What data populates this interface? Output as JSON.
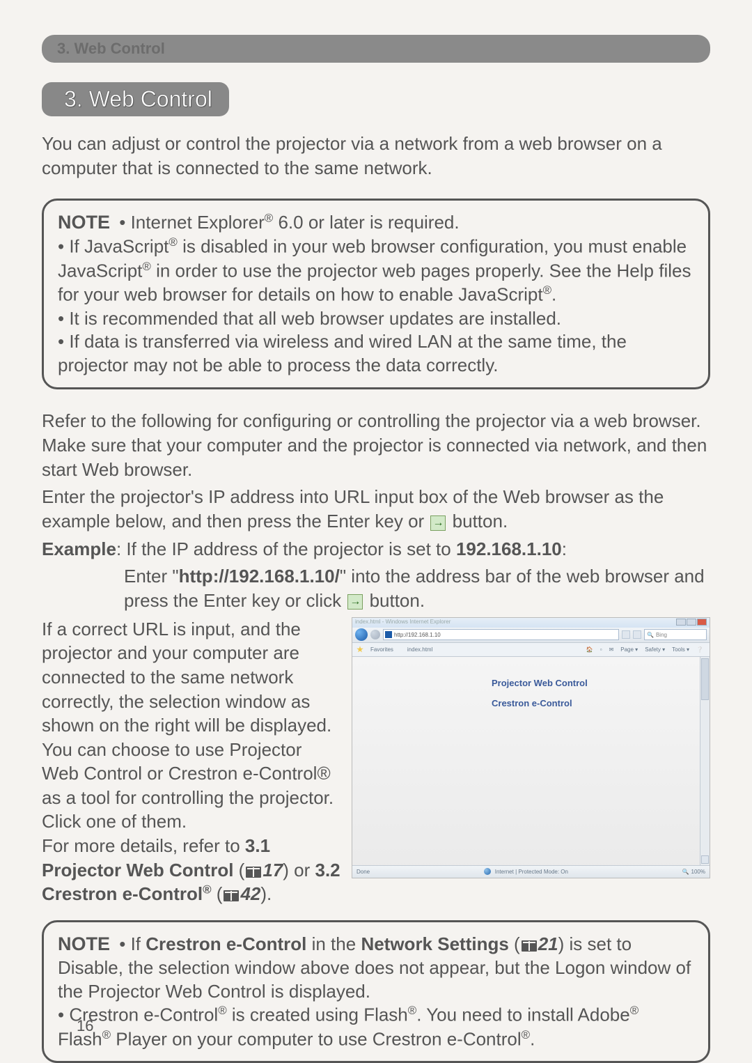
{
  "header": {
    "breadcrumb": "3. Web Control"
  },
  "section": {
    "title": "3. Web Control"
  },
  "intro": "You can adjust or control the projector via a network from a web browser on a computer that is connected to the same network.",
  "note1": {
    "label": "NOTE",
    "l1a": "• Internet Explorer",
    "l1b": " 6.0 or later is required.",
    "l2a": "• If JavaScript",
    "l2b": " is disabled in your web browser configuration, you must enable JavaScript",
    "l2c": " in order to use the projector web pages properly. See the Help files for your web browser for details on how to enable JavaScript",
    "l2d": ".",
    "l3": "• It is recommended that all web browser updates are installed.",
    "l4": "• If data is transferred via wireless and wired LAN at the same time, the projector may not be able to process the data correctly."
  },
  "body": {
    "p1": "Refer to the following for configuring or controlling the projector via a web browser. Make sure that your computer and the projector is connected via network, and then start Web browser.",
    "p2a": "Enter the projector's IP address into URL input box of the Web browser as the example below, and then press the Enter key or ",
    "p2b": " button.",
    "ex_label": "Example",
    "ex_a": ": If the IP address of the projector is set to ",
    "ex_ip": "192.168.1.10",
    "ex_b": ":",
    "ex_line2a": "Enter \"",
    "ex_url": "http://192.168.1.10/",
    "ex_line2b": "\" into the address bar of the web browser and press the Enter key or click ",
    "ex_line2c": " button."
  },
  "left": {
    "p1": "If a correct URL is input, and the projector and your computer are connected to the same network correctly, the selection window as shown on the right will be displayed. You can choose to use Projector Web Control or Crestron e-Control® as a tool for controlling the projector. Click one of them.",
    "p2a": "For more details, refer to ",
    "p2b": "3.1 Projector Web Control",
    "p2c": " (",
    "p2d": "17",
    "p2e": ") or ",
    "p2f": "3.2 Crestron e-Control",
    "p2g": " (",
    "p2h": "42",
    "p2i": ")."
  },
  "ie": {
    "title": "index.html - Windows Internet Explorer",
    "url": "http://192.168.1.10",
    "search_hint": "Bing",
    "fav": "Favorites",
    "tab": "index.html",
    "menu": {
      "home": "▾",
      "print": "▾",
      "read": "▾",
      "page": "Page ▾",
      "safety": "Safety ▾",
      "tools": "Tools ▾",
      "help": "▾"
    },
    "link1": "Projector Web Control",
    "link2": "Crestron e-Control",
    "status_done": "Done",
    "status_mode": "Internet | Protected Mode: On",
    "status_zoom": "100%"
  },
  "note2": {
    "label": "NOTE",
    "l1a": "• If ",
    "l1b": "Crestron e-Control",
    "l1c": " in the ",
    "l1d": "Network Settings",
    "l1e": " (",
    "l1f": "21",
    "l1g": ") is set to Disable, the selection window above does not appear, but the Logon window of the Projector Web Control is displayed.",
    "l2a": "• Crestron e-Control",
    "l2b": " is created using Flash",
    "l2c": ". You need to install Adobe",
    "l2d": " Flash",
    "l2e": " Player on your computer to use Crestron e-Control",
    "l2f": "."
  },
  "reg": "®",
  "page_number": "16"
}
